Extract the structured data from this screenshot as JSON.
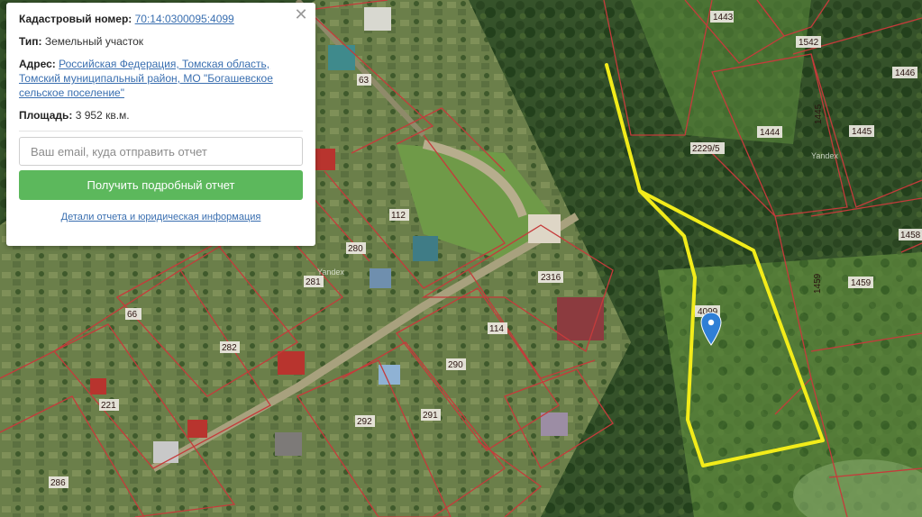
{
  "info_card": {
    "cadastral_label": "Кадастровый номер:",
    "cadastral_number": "70:14:0300095:4099",
    "type_label": "Тип:",
    "type_value": "Земельный участок",
    "address_label": "Адрес:",
    "address_line1": "Российская Федерация, Томская область,",
    "address_line2": "Томский муниципальный район, МО \"Богашевское",
    "address_line3": "сельское поселение\"",
    "area_label": "Площадь:",
    "area_value": "3 952 кв.м.",
    "email_placeholder": "Ваш email, куда отправить отчет",
    "report_button": "Получить подробный отчет",
    "details_link": "Детали отчета и юридическая информация",
    "close_icon": "close-icon"
  },
  "map": {
    "selected_plot": "4099",
    "plot_labels": [
      "1443",
      "1542",
      "1446",
      "63",
      "2229/5",
      "1445",
      "1444",
      "1445",
      "1458",
      "112",
      "280",
      "2316",
      "1459",
      "1459",
      "281",
      "66",
      "4099",
      "114",
      "282",
      "290",
      "221",
      "292",
      "291",
      "286"
    ],
    "watermarks": [
      "Yandex",
      "Yandex"
    ],
    "colors": {
      "boundary": "#c53b3b",
      "selected_boundary": "#f2ec1a",
      "marker": "#2f7fd6",
      "button_green": "#5cb85c",
      "link_blue": "#3a6fb0"
    },
    "marker_icon": "map-pin-icon"
  }
}
